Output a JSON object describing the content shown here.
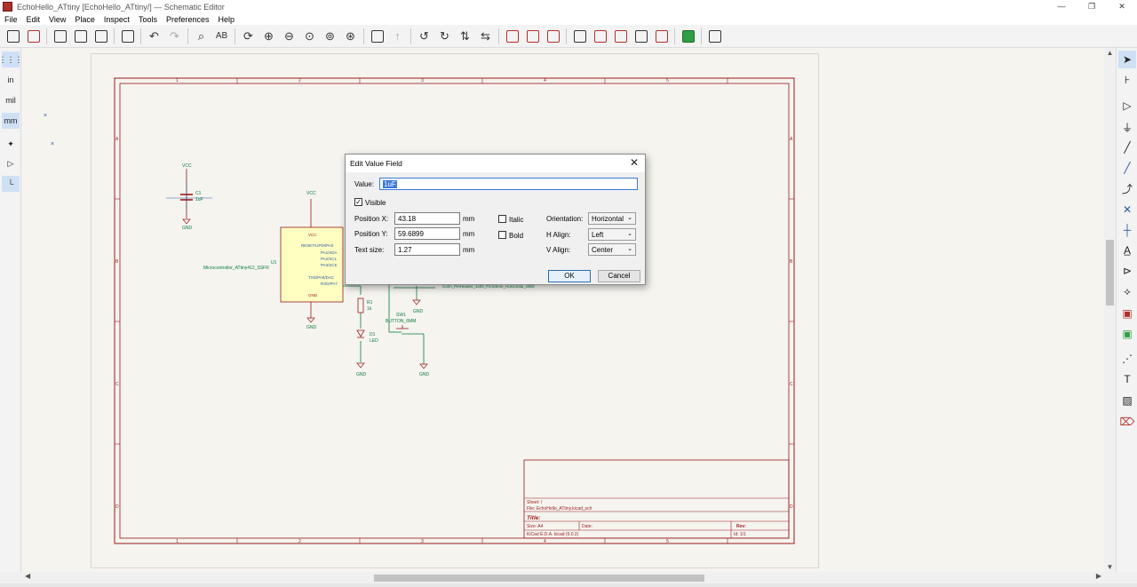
{
  "window": {
    "title": "EchoHello_ATtiny [EchoHello_ATtiny/] — Schematic Editor",
    "controls": [
      "—",
      "❐",
      "✕"
    ]
  },
  "menu": [
    "File",
    "Edit",
    "View",
    "Place",
    "Inspect",
    "Tools",
    "Preferences",
    "Help"
  ],
  "left_toolbar": {
    "units_in": "in",
    "units_mil": "mil",
    "units_mm": "mm"
  },
  "schematic": {
    "components": {
      "c1_ref": "C1",
      "c1_value": "1uF",
      "vcc1": "VCC",
      "gnd1": "GND",
      "vcc2": "VCC",
      "u1_ref": "U1",
      "u1_value": "Microcontroller_ATtiny412_SSFR",
      "u1_pins": [
        "RESET/UPDI/PA0",
        "PA1/SDA",
        "PA2/SCL",
        "PA3/SCK",
        "TXD/PA6/DAC",
        "RXD/PA7"
      ],
      "u1_vcc_pin": "VCC",
      "u1_gnd_pin": "GND",
      "gnd2": "GND",
      "r1_ref": "R1",
      "r1_value": "1k",
      "d1_ref": "D1",
      "d1_value": "LED",
      "sw1_ref": "SW1",
      "sw1_value": "BUTTON_6MM",
      "gnd3": "GND",
      "gnd4": "GND",
      "gnd5": "GND",
      "conn_value": "Conn_PinHeader_1x02_P2.54mm_Horizontal_SMD"
    },
    "border_cols": [
      "1",
      "2",
      "3",
      "4",
      "5"
    ],
    "border_rows": [
      "A",
      "B",
      "C",
      "D"
    ],
    "title_block": {
      "sheet": "Sheet: /",
      "file": "File: EchoHello_ATtiny.kicad_sch",
      "title": "Title:",
      "size": "Size: A4",
      "date": "Date:",
      "rev": "Rev:",
      "tool": "KiCad E.D.A.  kicad (6.0.2)",
      "id": "Id: 1/1"
    }
  },
  "dialog": {
    "title": "Edit Value Field",
    "value_label": "Value:",
    "value": "1uF",
    "visible_label": "Visible",
    "visible_checked": true,
    "pos_x_label": "Position X:",
    "pos_x": "43.18",
    "pos_y_label": "Position Y:",
    "pos_y": "59.6899",
    "text_size_label": "Text size:",
    "text_size": "1.27",
    "unit": "mm",
    "italic_label": "Italic",
    "bold_label": "Bold",
    "orientation_label": "Orientation:",
    "orientation": "Horizontal",
    "h_align_label": "H Align:",
    "h_align": "Left",
    "v_align_label": "V Align:",
    "v_align": "Center",
    "ok_label": "OK",
    "cancel_label": "Cancel"
  },
  "colors": {
    "wire": "#0a7a3a",
    "component": "#9a1a1a",
    "symbol_fill": "#ffffc2",
    "border": "#9a1a1a",
    "accent": "#3b7ad9"
  }
}
